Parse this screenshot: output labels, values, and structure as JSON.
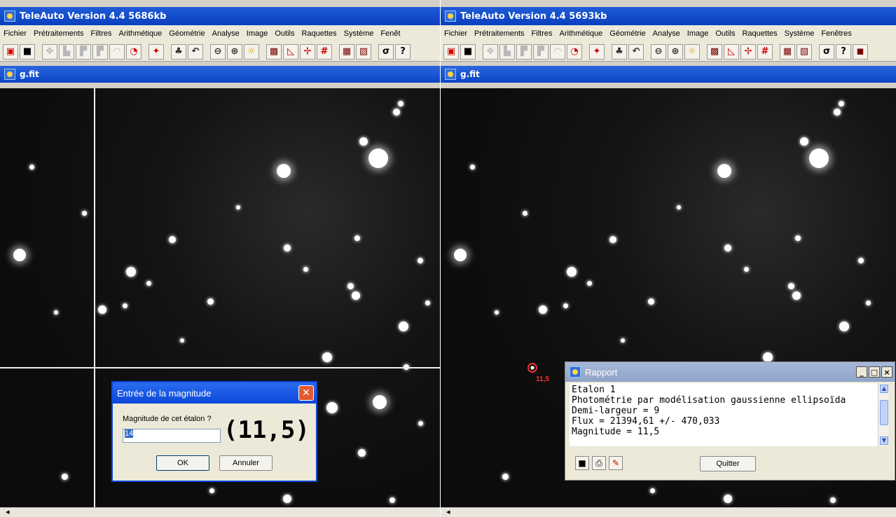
{
  "left_window": {
    "title": "TeleAuto Version 4.4 5686kb",
    "menu": [
      "Fichier",
      "Prétraitements",
      "Filtres",
      "Arithmétique",
      "Géométrie",
      "Analyse",
      "Image",
      "Outils",
      "Raquettes",
      "Système",
      "Fenêt"
    ],
    "image_title": "g.fit"
  },
  "right_window": {
    "title": "TeleAuto Version 4.4 5693kb",
    "menu": [
      "Fichier",
      "Prétraitements",
      "Filtres",
      "Arithmétique",
      "Géométrie",
      "Analyse",
      "Image",
      "Outils",
      "Raquettes",
      "Système",
      "Fenêtres"
    ],
    "image_title": "g.fit",
    "marker_label": "11,5"
  },
  "dialog": {
    "title": "Entrée de la magnitude",
    "prompt": "Magnitude de cet étalon ?",
    "input_value": "14",
    "annotation": "(11,5)",
    "ok_label": "OK",
    "cancel_label": "Annuler"
  },
  "rapport": {
    "title": "Rapport",
    "lines": [
      "Etalon 1",
      "Photométrie par modélisation gaussienne ellipsoïda",
      "Demi-largeur = 9",
      "Flux = 21394,61 +/- 470,033",
      "Magnitude = 11,5"
    ],
    "quit_label": "Quitter"
  },
  "toolbar_icons": [
    "open-icon",
    "save-icon",
    "move-icon",
    "bars-icon",
    "blank-icon",
    "blank-icon",
    "dome-icon",
    "clock-icon",
    "target-icon",
    "tree-icon",
    "undo-icon",
    "zoom-out-icon",
    "zoom-in-icon",
    "sun-icon",
    "film-icon",
    "triangle-icon",
    "cross-icon",
    "hash-icon",
    "grid-icon",
    "palette-icon",
    "sigma-icon",
    "help-icon"
  ]
}
